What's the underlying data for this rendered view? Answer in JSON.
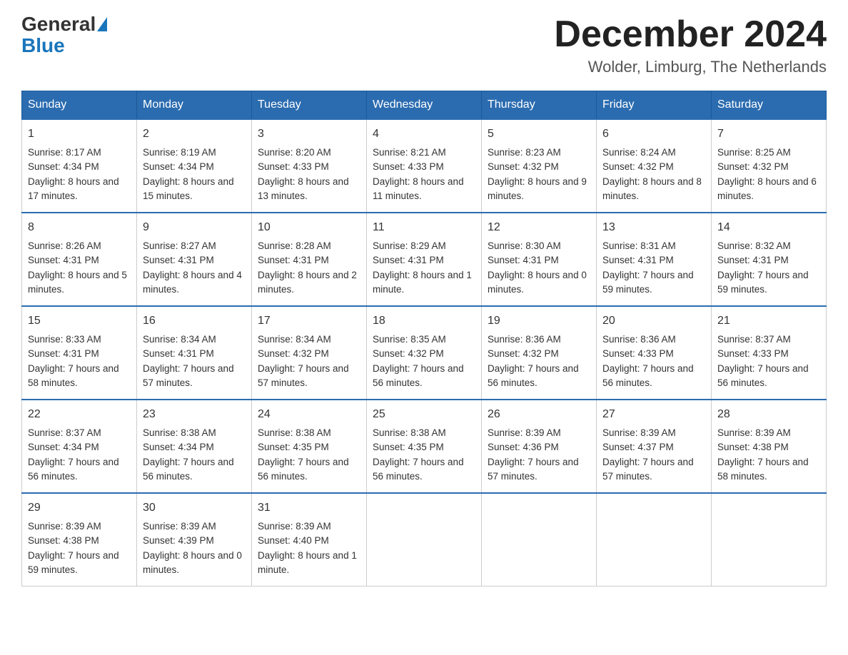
{
  "header": {
    "logo_general": "General",
    "logo_blue": "Blue",
    "month_year": "December 2024",
    "location": "Wolder, Limburg, The Netherlands"
  },
  "weekdays": [
    "Sunday",
    "Monday",
    "Tuesday",
    "Wednesday",
    "Thursday",
    "Friday",
    "Saturday"
  ],
  "weeks": [
    [
      {
        "day": "1",
        "sunrise": "8:17 AM",
        "sunset": "4:34 PM",
        "daylight": "8 hours and 17 minutes."
      },
      {
        "day": "2",
        "sunrise": "8:19 AM",
        "sunset": "4:34 PM",
        "daylight": "8 hours and 15 minutes."
      },
      {
        "day": "3",
        "sunrise": "8:20 AM",
        "sunset": "4:33 PM",
        "daylight": "8 hours and 13 minutes."
      },
      {
        "day": "4",
        "sunrise": "8:21 AM",
        "sunset": "4:33 PM",
        "daylight": "8 hours and 11 minutes."
      },
      {
        "day": "5",
        "sunrise": "8:23 AM",
        "sunset": "4:32 PM",
        "daylight": "8 hours and 9 minutes."
      },
      {
        "day": "6",
        "sunrise": "8:24 AM",
        "sunset": "4:32 PM",
        "daylight": "8 hours and 8 minutes."
      },
      {
        "day": "7",
        "sunrise": "8:25 AM",
        "sunset": "4:32 PM",
        "daylight": "8 hours and 6 minutes."
      }
    ],
    [
      {
        "day": "8",
        "sunrise": "8:26 AM",
        "sunset": "4:31 PM",
        "daylight": "8 hours and 5 minutes."
      },
      {
        "day": "9",
        "sunrise": "8:27 AM",
        "sunset": "4:31 PM",
        "daylight": "8 hours and 4 minutes."
      },
      {
        "day": "10",
        "sunrise": "8:28 AM",
        "sunset": "4:31 PM",
        "daylight": "8 hours and 2 minutes."
      },
      {
        "day": "11",
        "sunrise": "8:29 AM",
        "sunset": "4:31 PM",
        "daylight": "8 hours and 1 minute."
      },
      {
        "day": "12",
        "sunrise": "8:30 AM",
        "sunset": "4:31 PM",
        "daylight": "8 hours and 0 minutes."
      },
      {
        "day": "13",
        "sunrise": "8:31 AM",
        "sunset": "4:31 PM",
        "daylight": "7 hours and 59 minutes."
      },
      {
        "day": "14",
        "sunrise": "8:32 AM",
        "sunset": "4:31 PM",
        "daylight": "7 hours and 59 minutes."
      }
    ],
    [
      {
        "day": "15",
        "sunrise": "8:33 AM",
        "sunset": "4:31 PM",
        "daylight": "7 hours and 58 minutes."
      },
      {
        "day": "16",
        "sunrise": "8:34 AM",
        "sunset": "4:31 PM",
        "daylight": "7 hours and 57 minutes."
      },
      {
        "day": "17",
        "sunrise": "8:34 AM",
        "sunset": "4:32 PM",
        "daylight": "7 hours and 57 minutes."
      },
      {
        "day": "18",
        "sunrise": "8:35 AM",
        "sunset": "4:32 PM",
        "daylight": "7 hours and 56 minutes."
      },
      {
        "day": "19",
        "sunrise": "8:36 AM",
        "sunset": "4:32 PM",
        "daylight": "7 hours and 56 minutes."
      },
      {
        "day": "20",
        "sunrise": "8:36 AM",
        "sunset": "4:33 PM",
        "daylight": "7 hours and 56 minutes."
      },
      {
        "day": "21",
        "sunrise": "8:37 AM",
        "sunset": "4:33 PM",
        "daylight": "7 hours and 56 minutes."
      }
    ],
    [
      {
        "day": "22",
        "sunrise": "8:37 AM",
        "sunset": "4:34 PM",
        "daylight": "7 hours and 56 minutes."
      },
      {
        "day": "23",
        "sunrise": "8:38 AM",
        "sunset": "4:34 PM",
        "daylight": "7 hours and 56 minutes."
      },
      {
        "day": "24",
        "sunrise": "8:38 AM",
        "sunset": "4:35 PM",
        "daylight": "7 hours and 56 minutes."
      },
      {
        "day": "25",
        "sunrise": "8:38 AM",
        "sunset": "4:35 PM",
        "daylight": "7 hours and 56 minutes."
      },
      {
        "day": "26",
        "sunrise": "8:39 AM",
        "sunset": "4:36 PM",
        "daylight": "7 hours and 57 minutes."
      },
      {
        "day": "27",
        "sunrise": "8:39 AM",
        "sunset": "4:37 PM",
        "daylight": "7 hours and 57 minutes."
      },
      {
        "day": "28",
        "sunrise": "8:39 AM",
        "sunset": "4:38 PM",
        "daylight": "7 hours and 58 minutes."
      }
    ],
    [
      {
        "day": "29",
        "sunrise": "8:39 AM",
        "sunset": "4:38 PM",
        "daylight": "7 hours and 59 minutes."
      },
      {
        "day": "30",
        "sunrise": "8:39 AM",
        "sunset": "4:39 PM",
        "daylight": "8 hours and 0 minutes."
      },
      {
        "day": "31",
        "sunrise": "8:39 AM",
        "sunset": "4:40 PM",
        "daylight": "8 hours and 1 minute."
      },
      null,
      null,
      null,
      null
    ]
  ]
}
